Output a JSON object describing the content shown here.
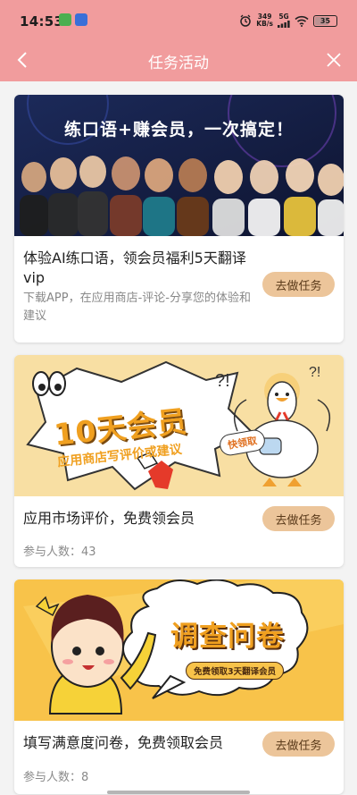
{
  "status_bar": {
    "time": "14:53",
    "net_speed_value": "349",
    "net_speed_unit": "KB/s",
    "network": "5G",
    "battery": "35"
  },
  "nav": {
    "title": "任务活动"
  },
  "tasks": [
    {
      "banner_headline": "练口语+赚会员，一次搞定！",
      "title": "体验AI练口语，领会员福利5天翻译vip",
      "desc": "下载APP，在应用商店-评论-分享您的体验和建议",
      "button": "去做任务"
    },
    {
      "banner_big": "10天会员",
      "banner_sub": "应用商店写评价或建议",
      "banner_tag": "快领取",
      "title": "应用市场评价，免费领会员",
      "count": "参与人数：43",
      "button": "去做任务"
    },
    {
      "banner_big": "调查问卷",
      "banner_sub": "免费领取3天翻译会员",
      "title": "填写满意度问卷，免费领取会员",
      "count": "参与人数：8",
      "button": "去做任务"
    }
  ],
  "colors": {
    "header": "#f19c9d",
    "button": "#ecc59a",
    "page_bg": "#f3f3f3"
  }
}
